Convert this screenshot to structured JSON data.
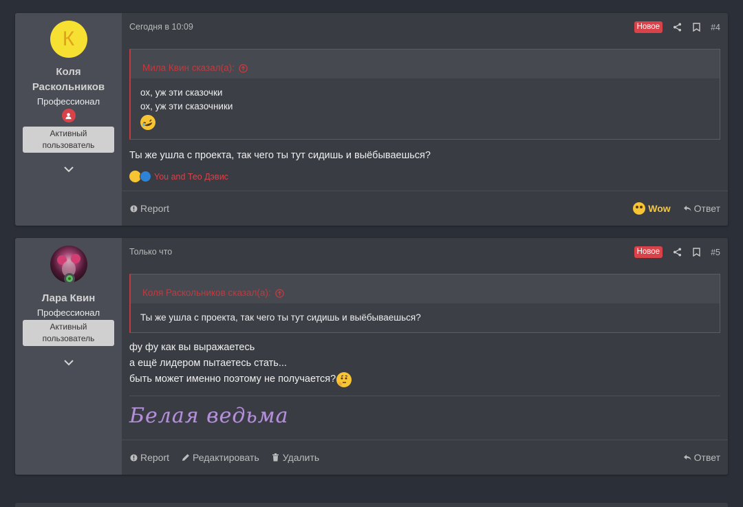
{
  "posts": [
    {
      "author": "Коля Раскольников",
      "avatar_letter": "К",
      "user_title": "Профессионал",
      "user_banner": "Активный пользователь",
      "time": "Сегодня в 10:09",
      "badge": "Новое",
      "number": "#4",
      "quote": {
        "author_line": "Мила Квин сказал(а):",
        "lines": [
          "ох, уж эти сказочки",
          "ох, уж эти сказочники"
        ]
      },
      "message_lines": [
        "Ты же ушла с проекта, так чего ты тут сидишь и выёбываешься?"
      ],
      "reactions_text": "You and Тео Дэвис",
      "footer": {
        "report": "Report",
        "reaction": "Wow",
        "reply": "Ответ"
      }
    },
    {
      "author": "Лара Квин",
      "user_title": "Профессионал",
      "user_banner": "Активный пользователь",
      "time": "Только что",
      "badge": "Новое",
      "number": "#5",
      "quote": {
        "author_line": "Коля Раскольников сказал(а):",
        "lines": [
          "Ты же ушла с проекта, так чего ты тут сидишь и выёбываешься?"
        ]
      },
      "message_lines": [
        "фу фу как вы выражаетесь",
        "а ещё лидером пытаетесь стать...",
        "быть может именно поэтому не получается?"
      ],
      "signature": "Белая ведьма",
      "footer": {
        "report": "Report",
        "edit": "Редактировать",
        "delete": "Удалить",
        "reply": "Ответ"
      }
    }
  ],
  "colors": {
    "accent_red": "#d8434a",
    "wow_yellow": "#f3c744",
    "signature_purple": "#b491d7"
  }
}
